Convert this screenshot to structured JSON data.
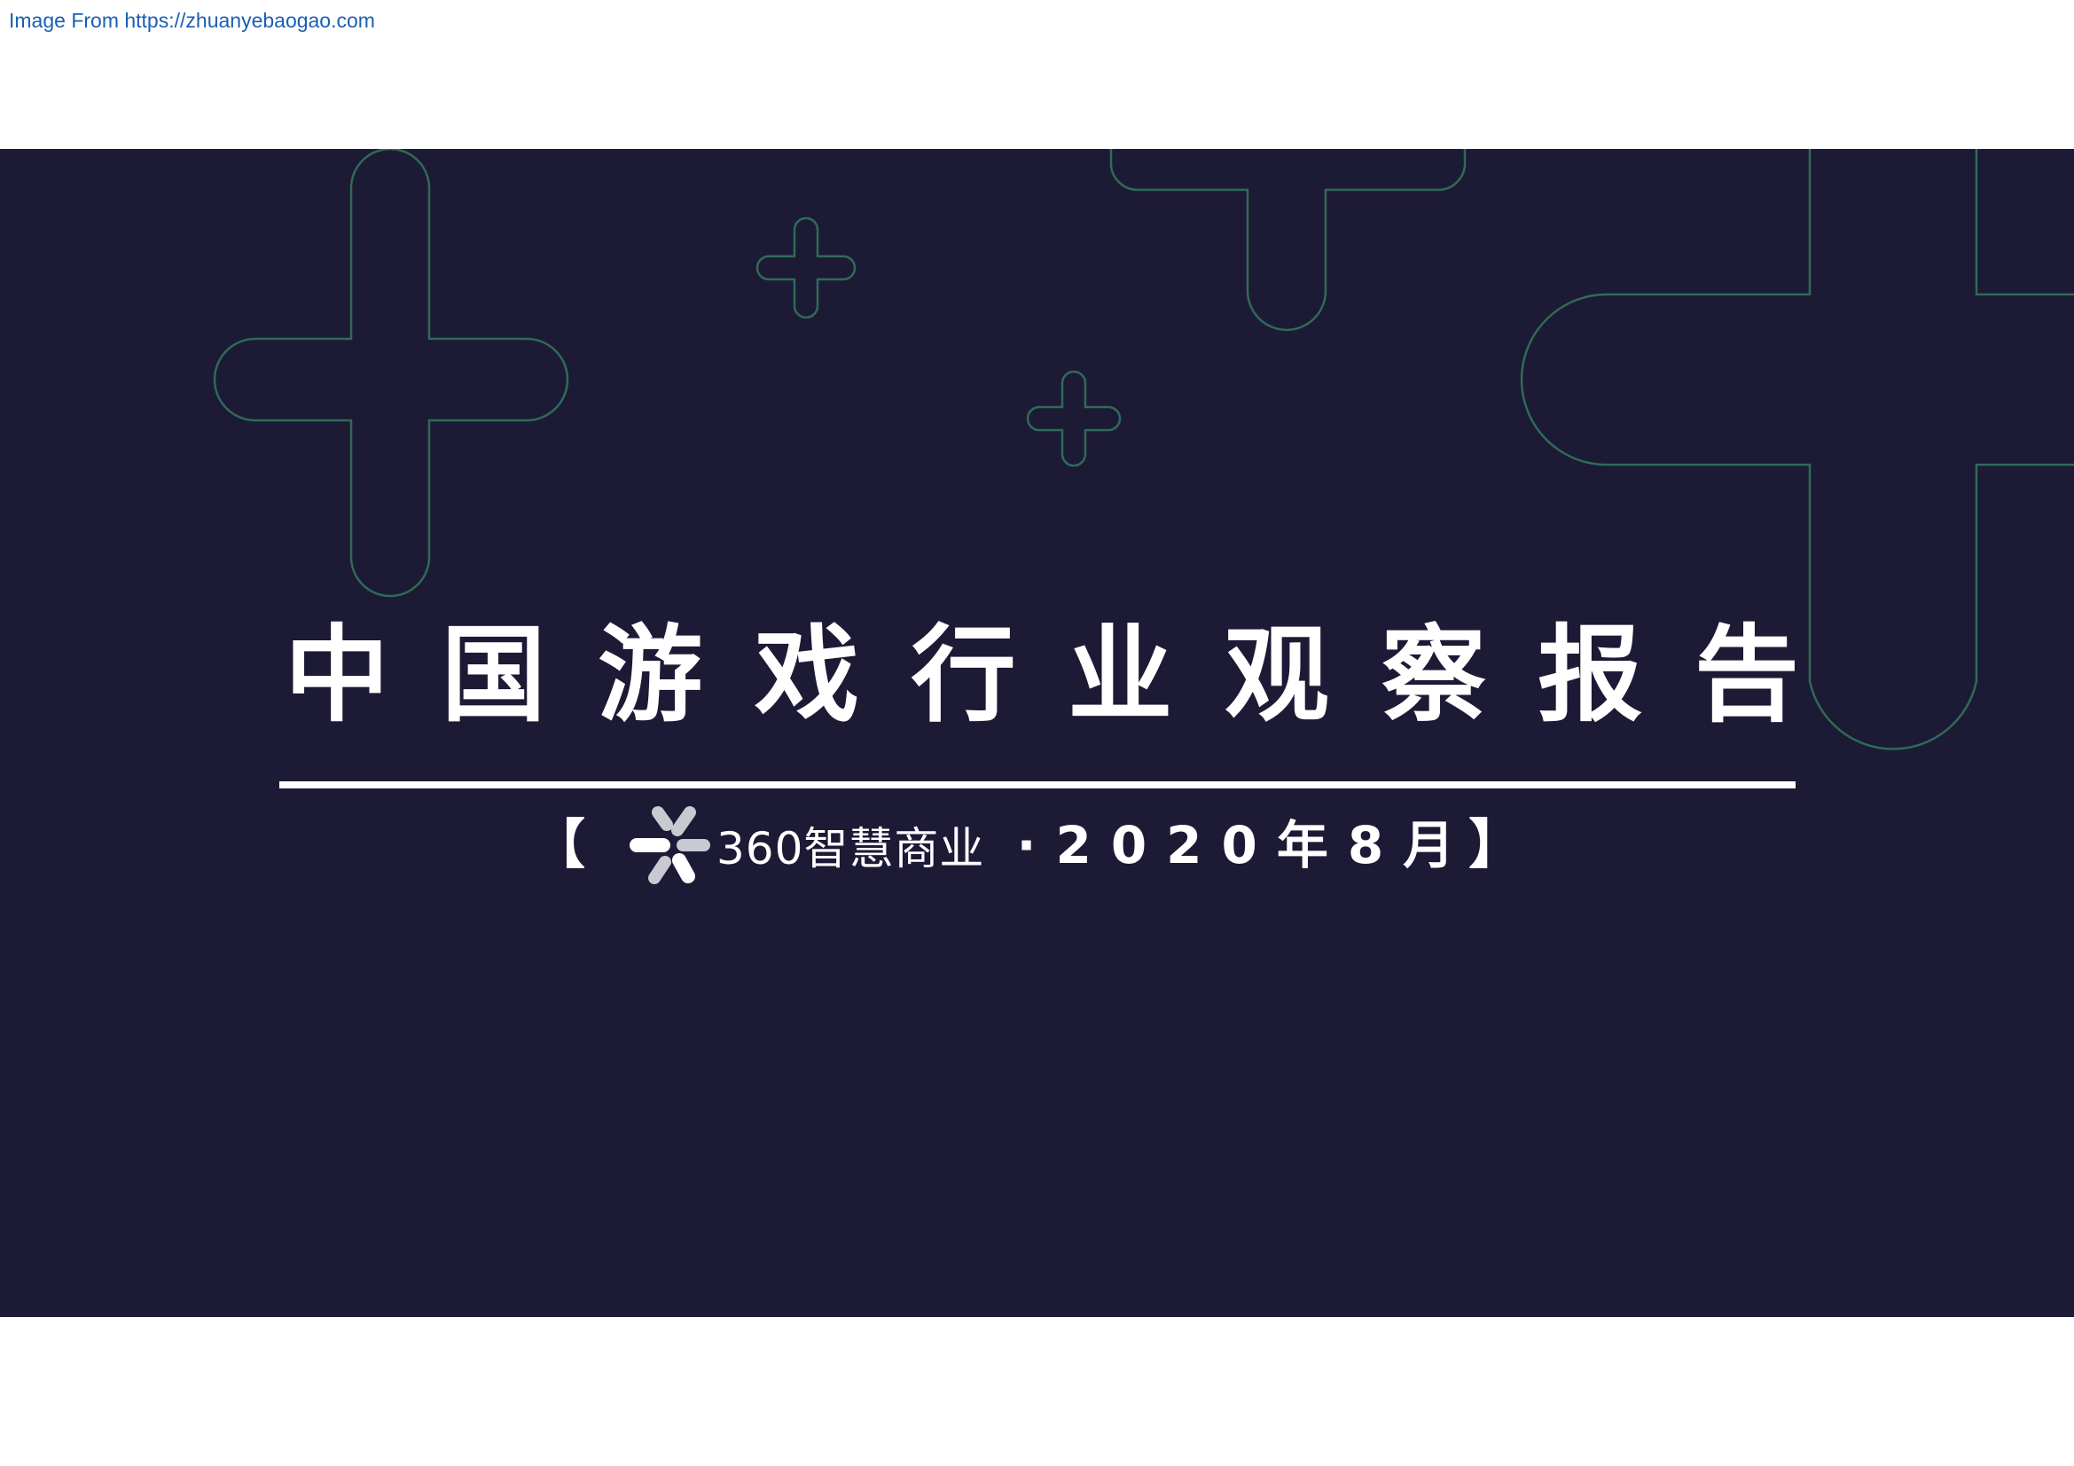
{
  "header": {
    "source_text": "Image From https://zhuanyebaogao.com"
  },
  "cover": {
    "title_chars": [
      "中",
      "国",
      "游",
      "戏",
      "行",
      "业",
      "观",
      "察",
      "报",
      "告"
    ],
    "bracket_open": "【",
    "logo_text": "360智慧商业",
    "date_text": "·2020年8月",
    "bracket_close": "】"
  },
  "colors": {
    "banner_background": "#1d1a36",
    "outline_accent": "#2f6b55",
    "text": "#ffffff",
    "link": "#1a5fb4"
  },
  "icons": {
    "logo_mark": "360-asterisk-logo-icon",
    "decoration": "plus-outline-icon"
  }
}
